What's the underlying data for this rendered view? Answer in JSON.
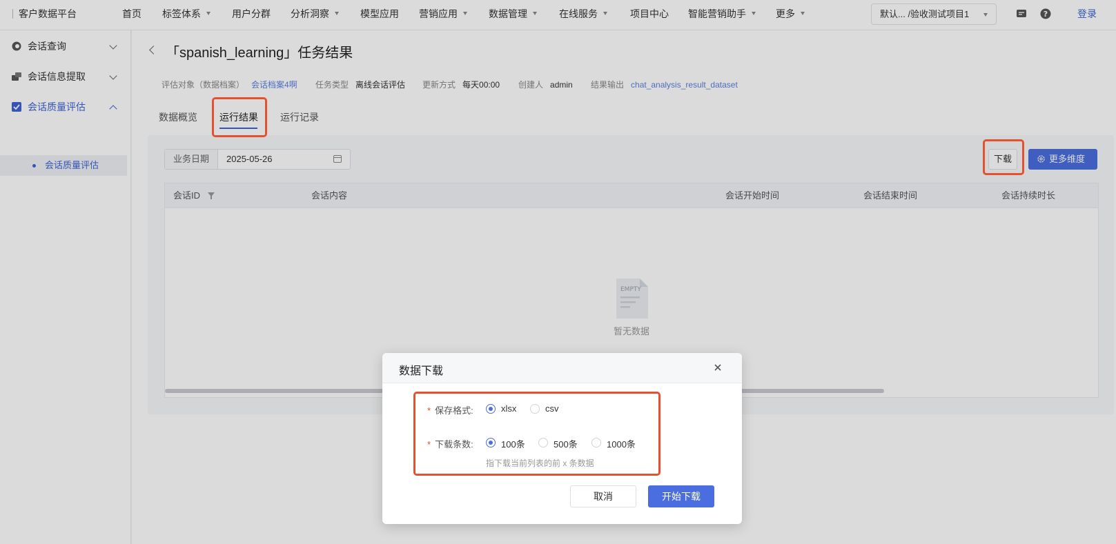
{
  "topbar": {
    "brand": "客户数据平台",
    "nav": [
      {
        "label": "首页",
        "caret": false
      },
      {
        "label": "标签体系",
        "caret": true
      },
      {
        "label": "用户分群",
        "caret": false
      },
      {
        "label": "分析洞察",
        "caret": true
      },
      {
        "label": "模型应用",
        "caret": false
      },
      {
        "label": "营销应用",
        "caret": true
      },
      {
        "label": "数据管理",
        "caret": true
      },
      {
        "label": "在线服务",
        "caret": true
      },
      {
        "label": "项目中心",
        "caret": false
      },
      {
        "label": "智能营销助手",
        "caret": true
      },
      {
        "label": "更多",
        "caret": true
      }
    ],
    "project_select": "默认... /验收测试项目1",
    "login": "登录"
  },
  "sidebar": {
    "items": [
      {
        "label": "会话查询",
        "icon": "chat-search-icon",
        "expanded": false
      },
      {
        "label": "会话信息提取",
        "icon": "info-extract-icon",
        "expanded": false
      },
      {
        "label": "会话质量评估",
        "icon": "checkbox-icon",
        "expanded": true
      }
    ],
    "sub_item": "会话质量评估"
  },
  "page": {
    "title": "「spanish_learning」任务结果",
    "meta": [
      {
        "key": "评估对象（数据档案）",
        "value": "会话档案4啊",
        "link": true
      },
      {
        "key": "任务类型",
        "value": "离线会话评估",
        "link": false
      },
      {
        "key": "更新方式",
        "value": "每天00:00",
        "link": false
      },
      {
        "key": "创建人",
        "value": "admin",
        "link": false
      },
      {
        "key": "结果输出",
        "value": "chat_analysis_result_dataset",
        "link": true
      }
    ],
    "tabs": [
      "数据概览",
      "运行结果",
      "运行记录"
    ],
    "active_tab": "运行结果"
  },
  "toolbar": {
    "date_label": "业务日期",
    "date_value": "2025-05-26",
    "download": "下载",
    "more_dims": "更多维度"
  },
  "table": {
    "columns": [
      "会话ID",
      "会话内容",
      "会话开始时间",
      "会话结束时间",
      "会话持续时长"
    ],
    "empty_icon_text": "EMPTY",
    "empty_text": "暂无数据"
  },
  "modal": {
    "title": "数据下载",
    "format_label": "保存格式:",
    "format_options": [
      "xlsx",
      "csv"
    ],
    "format_selected": "xlsx",
    "count_label": "下载条数:",
    "count_options": [
      "100条",
      "500条",
      "1000条"
    ],
    "count_selected": "100条",
    "hint": "指下载当前列表的前 x 条数据",
    "cancel": "取消",
    "start": "开始下载"
  },
  "colors": {
    "accent": "#4a6ee0",
    "highlight": "#e5502f"
  }
}
